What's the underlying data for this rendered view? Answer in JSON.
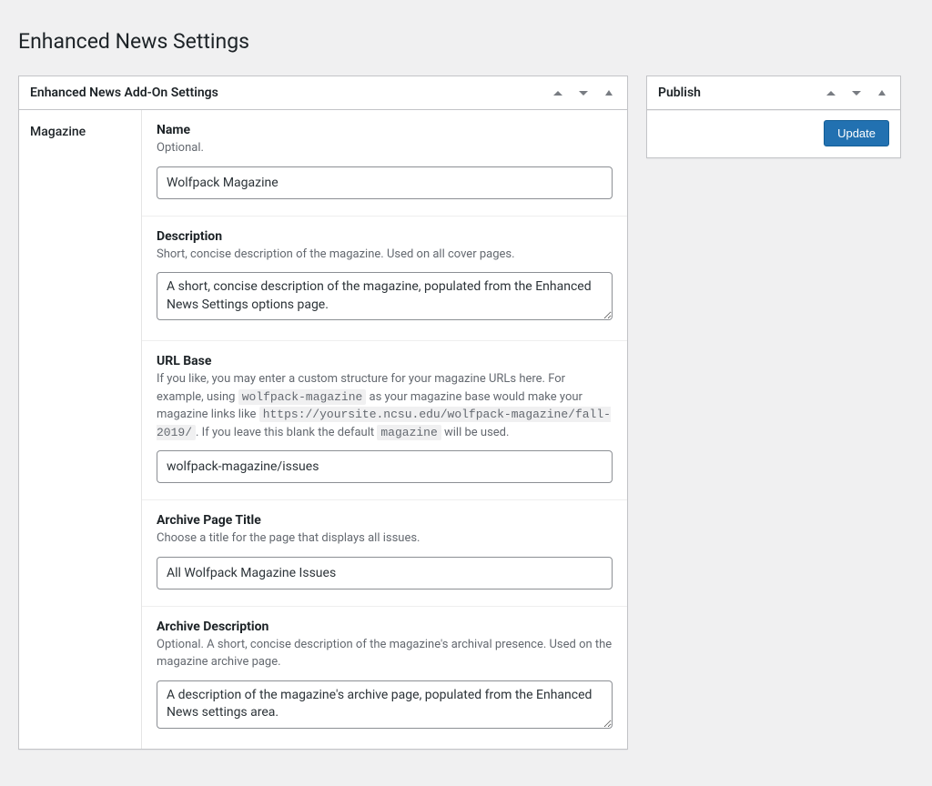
{
  "page": {
    "title": "Enhanced News Settings"
  },
  "main_box": {
    "title": "Enhanced News Add-On Settings",
    "tabs": [
      {
        "label": "Magazine"
      }
    ],
    "fields": {
      "name": {
        "label": "Name",
        "help": "Optional.",
        "value": "Wolfpack Magazine"
      },
      "description": {
        "label": "Description",
        "help": "Short, concise description of the magazine. Used on all cover pages.",
        "value": "A short, concise description of the magazine, populated from the Enhanced News Settings options page."
      },
      "url_base": {
        "label": "URL Base",
        "help_pre": "If you like, you may enter a custom structure for your magazine URLs here. For example, using ",
        "code1": "wolfpack-magazine",
        "help_mid1": " as your magazine base would make your magazine links like ",
        "code2": "https://yoursite.ncsu.edu/wolfpack-magazine/fall-2019/",
        "help_mid2": ". If you leave this blank the default ",
        "code3": "magazine",
        "help_post": " will be used.",
        "value": "wolfpack-magazine/issues"
      },
      "archive_title": {
        "label": "Archive Page Title",
        "help": "Choose a title for the page that displays all issues.",
        "value": "All Wolfpack Magazine Issues"
      },
      "archive_description": {
        "label": "Archive Description",
        "help": "Optional. A short, concise description of the magazine's archival presence. Used on the magazine archive page.",
        "value": "A description of the magazine's archive page, populated from the Enhanced News settings area."
      }
    }
  },
  "publish_box": {
    "title": "Publish",
    "button": "Update"
  }
}
